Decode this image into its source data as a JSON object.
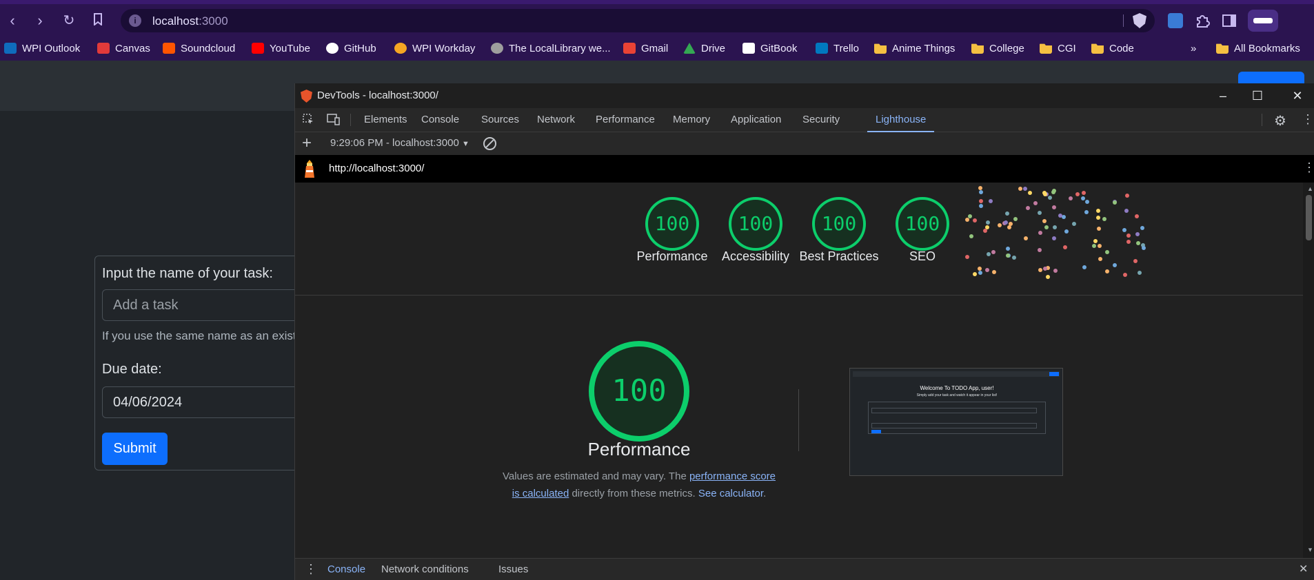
{
  "browser": {
    "url_host": "localhost",
    "url_port": ":3000",
    "bookmarks": [
      {
        "label": "WPI Outlook",
        "icon": "outlook-icon",
        "color": "#0f6cbd"
      },
      {
        "label": "Canvas",
        "icon": "canvas-icon",
        "color": "#e13a3a"
      },
      {
        "label": "Soundcloud",
        "icon": "soundcloud-icon",
        "color": "#ff5500"
      },
      {
        "label": "YouTube",
        "icon": "youtube-icon",
        "color": "#ff0000"
      },
      {
        "label": "GitHub",
        "icon": "github-icon",
        "color": "#ffffff"
      },
      {
        "label": "WPI Workday",
        "icon": "workday-icon",
        "color": "#f5a623"
      },
      {
        "label": "The LocalLibrary we...",
        "icon": "globe-icon",
        "color": "#9e9e9e"
      },
      {
        "label": "Gmail",
        "icon": "gmail-icon",
        "color": "#ea4335"
      },
      {
        "label": "Drive",
        "icon": "drive-icon",
        "color": "#34a853"
      },
      {
        "label": "GitBook",
        "icon": "gitbook-icon",
        "color": "#ffffff"
      },
      {
        "label": "Trello",
        "icon": "trello-icon",
        "color": "#0079bf"
      },
      {
        "label": "Anime Things",
        "icon": "folder-icon",
        "color": "#f5c042"
      },
      {
        "label": "College",
        "icon": "folder-icon",
        "color": "#f5c042"
      },
      {
        "label": "CGI",
        "icon": "folder-icon",
        "color": "#f5c042"
      },
      {
        "label": "Code",
        "icon": "folder-icon",
        "color": "#f5c042"
      }
    ],
    "more_bookmarks": "»",
    "all_bookmarks": "All Bookmarks"
  },
  "page": {
    "task_label": "Input the name of your task:",
    "task_placeholder": "Add a task",
    "help_text": "If you use the same name as an exist",
    "due_label": "Due date:",
    "due_value": "04/06/2024",
    "submit": "Submit"
  },
  "devtools": {
    "title": "DevTools - localhost:3000/",
    "tabs": [
      "Elements",
      "Console",
      "Sources",
      "Network",
      "Performance",
      "Memory",
      "Application",
      "Security",
      "Lighthouse"
    ],
    "active_tab": "Lighthouse",
    "report_selector": "9:29:06 PM - localhost:3000",
    "report_url": "http://localhost:3000/",
    "scores": [
      {
        "label": "Performance",
        "score": "100"
      },
      {
        "label": "Accessibility",
        "score": "100"
      },
      {
        "label": "Best Practices",
        "score": "100"
      },
      {
        "label": "SEO",
        "score": "100"
      }
    ],
    "main_score": "100",
    "main_title": "Performance",
    "note_1": "Values are estimated and may vary. The ",
    "note_link_1": "performance score is calculated",
    "note_2": " directly from these metrics. ",
    "note_link_2": "See calculator",
    "note_3": ".",
    "drawer_tabs": [
      "Console",
      "Network conditions",
      "Issues"
    ],
    "thumbnail": {
      "heading": "Welcome To TODO App, user!",
      "subheading": "Simply add your task and watch it appear in your list!"
    },
    "score_color": "#0cce6b",
    "link_color": "#8ab4f8"
  }
}
